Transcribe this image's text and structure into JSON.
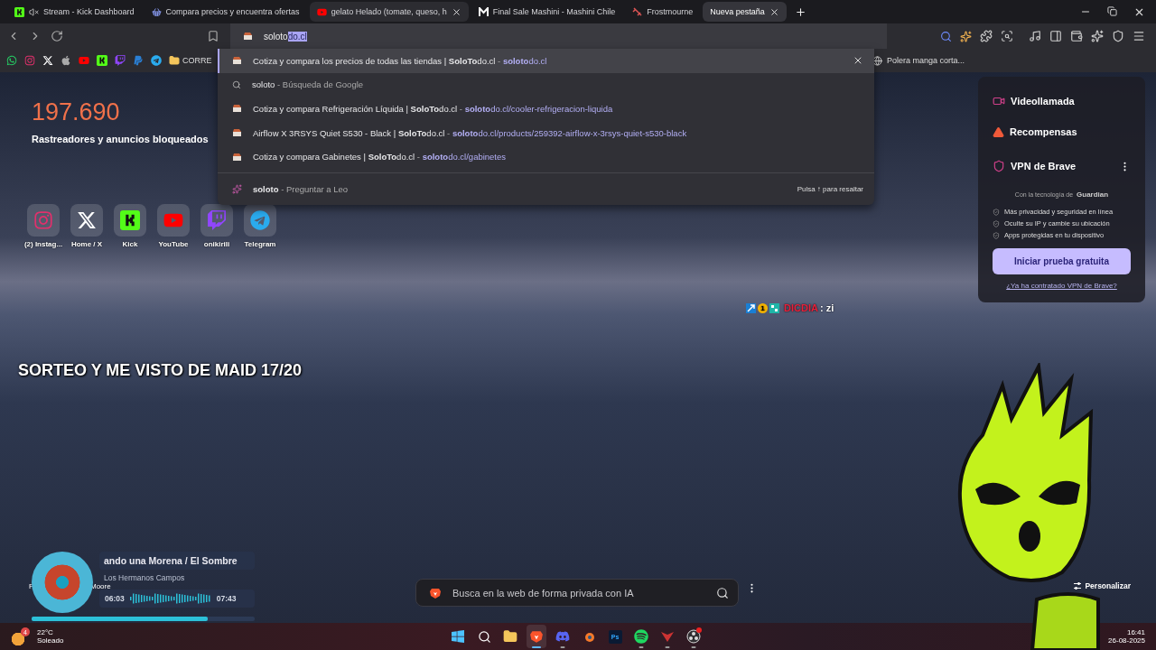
{
  "stream_overlay": {
    "title": "SORTEO Y ME VISTO DE MAID 17/20"
  },
  "tabs": [
    {
      "label": "Stream - Kick Dashboard",
      "muted": true,
      "hovered": false,
      "selected": false
    },
    {
      "label": "Compara precios y encuentra ofertas",
      "muted": false,
      "hovered": false,
      "selected": false
    },
    {
      "label": "gelato Helado (tomate, queso, h",
      "muted": false,
      "hovered": true,
      "selected": false
    },
    {
      "label": "Final Sale Mashini - Mashini Chile",
      "muted": false,
      "hovered": false,
      "selected": false
    },
    {
      "label": "Frostmourne",
      "muted": false,
      "hovered": false,
      "selected": false
    },
    {
      "label": "Nueva pestaña",
      "muted": false,
      "hovered": false,
      "selected": true
    }
  ],
  "address": {
    "typed": "soloto",
    "completion": "do.cl"
  },
  "bookmarks": {
    "folder": "CORRE",
    "right": "Polera manga corta..."
  },
  "suggestions": [
    {
      "kind": "site",
      "title": "Cotiza y compara los precios de todas las tiendas | **SoloTo**do.cl",
      "separator": "-",
      "url": "**soloto**do.cl",
      "selected": true
    },
    {
      "kind": "search",
      "title": "soloto",
      "separator": "-",
      "detail": "Búsqueda de Google",
      "selected": false
    },
    {
      "kind": "site",
      "title": "Cotiza y compara Refrigeración Líquida | **SoloTo**do.cl",
      "separator": "-",
      "url": "**soloto**do.cl/cooler-refrigeracion-liquida",
      "selected": false
    },
    {
      "kind": "site",
      "title": "Airflow X 3RSYS Quiet S530 - Black | **SoloTo**do.cl",
      "separator": "-",
      "url": "**soloto**do.cl/products/259392-airflow-x-3rsys-quiet-s530-black",
      "selected": false
    },
    {
      "kind": "site",
      "title": "Cotiza y compara Gabinetes | **SoloTo**do.cl",
      "separator": "-",
      "url": "**soloto**do.cl/gabinetes",
      "selected": false
    },
    {
      "kind": "leo",
      "title": "soloto",
      "separator": "-",
      "detail": "Preguntar a Leo",
      "hint": "Pulsa ↑ para resaltar",
      "selected": false
    }
  ],
  "stats": {
    "value": "197.690",
    "label": "Rastreadores y anuncios bloqueados"
  },
  "shortcuts": [
    "(2) Instag...",
    "Home / X",
    "Kick",
    "YouTube",
    "onikirili",
    "Telegram"
  ],
  "side_panel": {
    "items": [
      "Videollamada",
      "Recompensas"
    ],
    "vpn": {
      "title": "VPN de Brave",
      "powered_by": "Con la tecnología de",
      "partner": "Guardian",
      "features": [
        "Más privacidad y seguridad en línea",
        "Oculte su IP y cambie su ubicación",
        "Apps protegidas en tu dispositivo"
      ],
      "button": "Iniciar prueba gratuita",
      "link": "¿Ya ha contratado VPN de Brave?"
    }
  },
  "chat": {
    "badge": "1",
    "user": "DICDIA",
    "separator": ":",
    "message": "zi"
  },
  "player": {
    "title": "ando una Morena / El Sombre",
    "artist": "Los Hermanos Campos",
    "elapsed": "06:03",
    "total": "07:43",
    "level": 0.79,
    "background_texts": [
      "F",
      "Moore"
    ]
  },
  "search": {
    "placeholder": "Busca en la web de forma privada con IA"
  },
  "customize": {
    "label": "Personalizar"
  },
  "taskbar": {
    "weather": {
      "badge": "4",
      "temp": "22°C",
      "condition": "Soleado"
    },
    "apps": [
      {
        "running": false,
        "active": false
      },
      {
        "running": false,
        "active": false
      },
      {
        "running": false,
        "active": false
      },
      {
        "running": true,
        "active": true
      },
      {
        "running": true,
        "active": false
      },
      {
        "running": false,
        "active": false
      },
      {
        "label": "Ps",
        "running": false,
        "active": false
      },
      {
        "running": true,
        "active": false
      },
      {
        "running": true,
        "active": false
      },
      {
        "running": true,
        "active": false,
        "notification": true
      }
    ],
    "clock": {
      "time": "16:41",
      "date": "26-08-2025"
    }
  }
}
